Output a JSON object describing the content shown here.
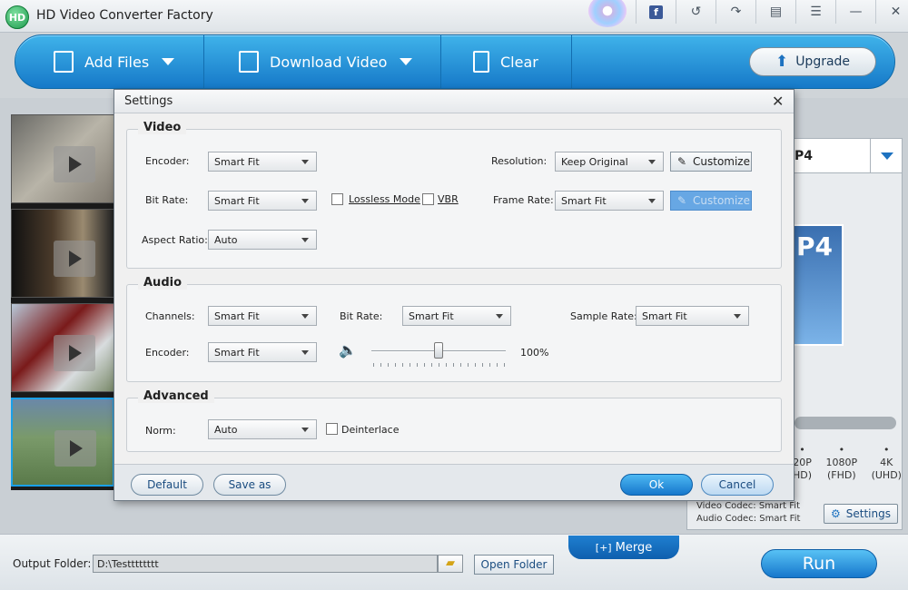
{
  "app": {
    "title": "HD Video Converter Factory",
    "logo_text": "HD"
  },
  "window_icons": [
    "disc-icon",
    "facebook-icon",
    "refresh-icon",
    "share-icon",
    "feedback-icon",
    "menu-icon",
    "minimize-icon",
    "close-icon"
  ],
  "toolbar": {
    "add_files": "Add Files",
    "download_video": "Download Video",
    "clear": "Clear",
    "upgrade": "Upgrade"
  },
  "right_panel": {
    "format_label": "P4",
    "art_text": "P4",
    "resolutions": [
      {
        "top": "20P",
        "bottom": "HD)"
      },
      {
        "top": "1080P",
        "bottom": "(FHD)"
      },
      {
        "top": "4K",
        "bottom": "(UHD)"
      }
    ],
    "video_codec": "Video Codec: Smart Fit",
    "audio_codec": "Audio Codec: Smart Fit",
    "settings_label": "Settings"
  },
  "merge_label": "Merge",
  "merge_icon_text": "[+]",
  "bottom": {
    "output_label": "Output Folder:",
    "output_path": "D:\\Testttttttt",
    "open_folder": "Open Folder",
    "run": "Run"
  },
  "dialog": {
    "title": "Settings",
    "video": {
      "title": "Video",
      "encoder_label": "Encoder:",
      "encoder_value": "Smart Fit",
      "bitrate_label": "Bit Rate:",
      "bitrate_value": "Smart Fit",
      "lossless_label": "Lossless Mode",
      "vbr_label": "VBR",
      "aspect_label": "Aspect Ratio:",
      "aspect_value": "Auto",
      "resolution_label": "Resolution:",
      "resolution_value": "Keep Original",
      "customize1": "Customize",
      "framerate_label": "Frame Rate:",
      "framerate_value": "Smart Fit",
      "customize2": "Customize"
    },
    "audio": {
      "title": "Audio",
      "channels_label": "Channels:",
      "channels_value": "Smart Fit",
      "bitrate_label": "Bit Rate:",
      "bitrate_value": "Smart Fit",
      "samplerate_label": "Sample Rate:",
      "samplerate_value": "Smart Fit",
      "encoder_label": "Encoder:",
      "encoder_value": "Smart Fit",
      "volume_text": "100%",
      "volume_level": 0.5
    },
    "advanced": {
      "title": "Advanced",
      "norm_label": "Norm:",
      "norm_value": "Auto",
      "deinterlace_label": "Deinterlace"
    },
    "buttons": {
      "default": "Default",
      "save_as": "Save as",
      "ok": "Ok",
      "cancel": "Cancel"
    }
  }
}
